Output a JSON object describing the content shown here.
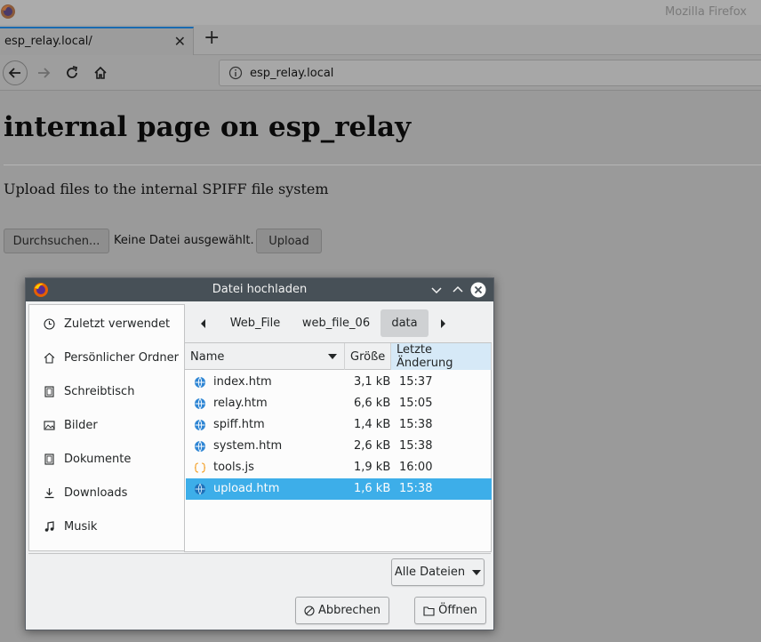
{
  "window": {
    "title": "Mozilla Firefox"
  },
  "tabs": [
    {
      "label": "esp_relay.local/"
    }
  ],
  "urlbar": {
    "url": "esp_relay.local"
  },
  "page": {
    "heading": "internal page on esp_relay",
    "description": "Upload files to the internal SPIFF file system",
    "browse_label": "Durchsuchen...",
    "no_file_label": "Keine Datei ausgewählt.",
    "upload_label": "Upload"
  },
  "dialog": {
    "title": "Datei hochladen",
    "places": [
      {
        "label": "Zuletzt verwendet",
        "icon": "clock-icon"
      },
      {
        "label": "Persönlicher Ordner",
        "icon": "home-icon"
      },
      {
        "label": "Schreibtisch",
        "icon": "desktop-icon"
      },
      {
        "label": "Bilder",
        "icon": "image-icon"
      },
      {
        "label": "Dokumente",
        "icon": "document-icon"
      },
      {
        "label": "Downloads",
        "icon": "download-icon"
      },
      {
        "label": "Musik",
        "icon": "music-icon"
      }
    ],
    "breadcrumbs": [
      "Web_File",
      "web_file_06",
      "data"
    ],
    "active_crumb": "data",
    "columns": {
      "name": "Name",
      "size": "Größe",
      "modified": "Letzte Änderung"
    },
    "files": [
      {
        "name": "index.htm",
        "size": "3,1 kB",
        "time": "15:37",
        "type": "html"
      },
      {
        "name": "relay.htm",
        "size": "6,6 kB",
        "time": "15:05",
        "type": "html"
      },
      {
        "name": "spiff.htm",
        "size": "1,4 kB",
        "time": "15:38",
        "type": "html"
      },
      {
        "name": "system.htm",
        "size": "2,6 kB",
        "time": "15:38",
        "type": "html"
      },
      {
        "name": "tools.js",
        "size": "1,9 kB",
        "time": "16:00",
        "type": "js"
      },
      {
        "name": "upload.htm",
        "size": "1,6 kB",
        "time": "15:38",
        "type": "html",
        "selected": true
      }
    ],
    "filter_label": "Alle Dateien",
    "cancel_label": "Abbrechen",
    "open_label": "Öffnen",
    "selection_color": "#3daee9",
    "titlebar_color": "#475057"
  }
}
